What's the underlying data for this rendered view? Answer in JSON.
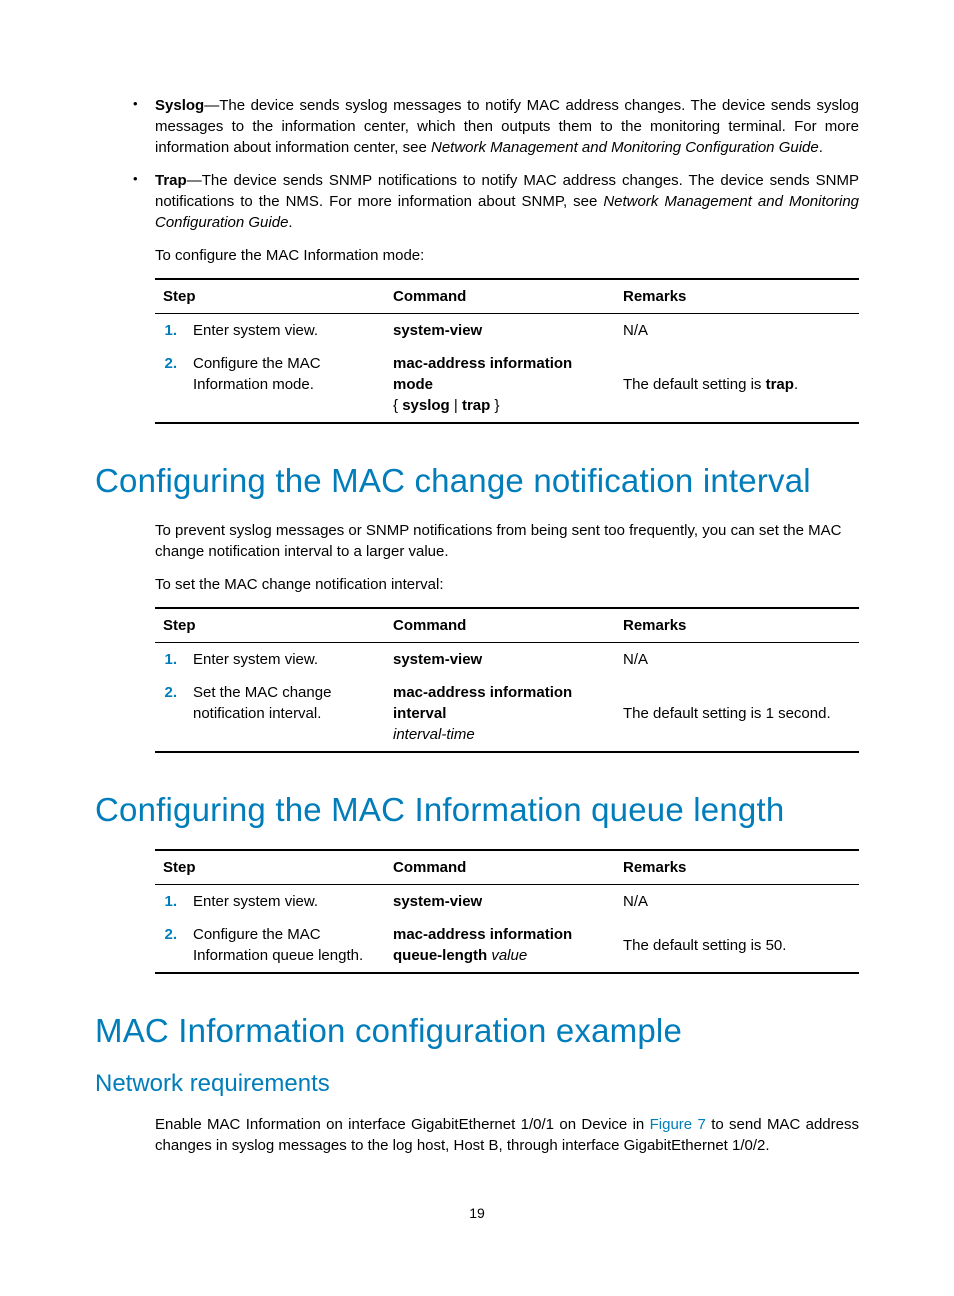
{
  "bullets": [
    {
      "term": "Syslog",
      "text_before_ref": "—The device sends syslog messages to notify MAC address changes. The device sends syslog messages to the information center, which then outputs them to the monitoring terminal. For more information about information center, see ",
      "ref": "Network Management and Monitoring Configuration Guide",
      "text_after_ref": "."
    },
    {
      "term": "Trap",
      "text_before_ref": "—The device sends SNMP notifications to notify MAC address changes. The device sends SNMP notifications to the NMS. For more information about SNMP, see ",
      "ref": "Network Management and Monitoring Configuration Guide",
      "text_after_ref": "."
    }
  ],
  "intro1": "To configure the MAC Information mode:",
  "table_headers": {
    "step": "Step",
    "command": "Command",
    "remarks": "Remarks"
  },
  "table1": [
    {
      "num": "1.",
      "step": "Enter system view.",
      "cmd_bold": "system-view",
      "cmd_rest": "",
      "remarks_plain": "N/A",
      "remarks_bold": ""
    },
    {
      "num": "2.",
      "step": "Configure the MAC Information mode.",
      "cmd_bold": "mac-address information mode",
      "cmd_rest": " { syslog | trap }",
      "remarks_plain": "The default setting is ",
      "remarks_bold": "trap",
      "remarks_tail": "."
    }
  ],
  "heading1": "Configuring the MAC change notification interval",
  "para1": "To prevent syslog messages or SNMP notifications from being sent too frequently, you can set the MAC change notification interval to a larger value.",
  "intro2": "To set the MAC change notification interval:",
  "table2": [
    {
      "num": "1.",
      "step": "Enter system view.",
      "cmd_bold": "system-view",
      "cmd_ital": "",
      "remarks": "N/A"
    },
    {
      "num": "2.",
      "step": "Set the MAC change notification interval.",
      "cmd_bold": "mac-address information interval",
      "cmd_ital": "interval-time",
      "remarks": "The default setting is 1 second."
    }
  ],
  "heading2": "Configuring the MAC Information queue length",
  "table3": [
    {
      "num": "1.",
      "step": "Enter system view.",
      "cmd_bold": "system-view",
      "cmd_ital": "",
      "remarks": "N/A"
    },
    {
      "num": "2.",
      "step": "Configure the MAC Information queue length.",
      "cmd_bold": "mac-address information queue-length",
      "cmd_ital": " value",
      "remarks": "The default setting is 50."
    }
  ],
  "heading3": "MAC Information configuration example",
  "subheading": "Network requirements",
  "para_net_before": "Enable MAC Information on interface GigabitEthernet 1/0/1 on Device in ",
  "para_net_link": "Figure 7",
  "para_net_after": " to send MAC address changes in syslog messages to the log host, Host B, through interface GigabitEthernet 1/0/2.",
  "page_number": "19"
}
